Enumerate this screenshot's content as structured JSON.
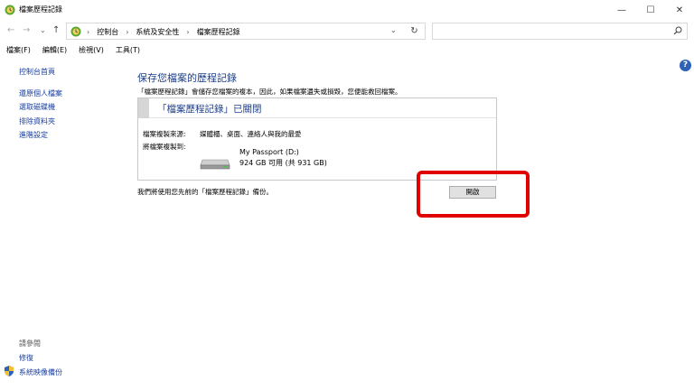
{
  "window": {
    "title": "檔案歷程記錄",
    "minimize": "—",
    "maximize": "☐",
    "close": "✕"
  },
  "address": {
    "back": "←",
    "forward": "→",
    "history": "⌄",
    "up": "↑",
    "crumbs": [
      "控制台",
      "系統及安全性",
      "檔案歷程記錄"
    ],
    "separator": "›",
    "dropdown": "⌄",
    "refresh": "↻",
    "search_placeholder": "",
    "search_icon": "⚲"
  },
  "menu": [
    "檔案(F)",
    "編輯(E)",
    "檢視(V)",
    "工具(T)"
  ],
  "sidebar": {
    "home": "控制台首頁",
    "items": [
      "還原個人檔案",
      "選取磁碟機",
      "排除資料夾",
      "進階設定"
    ],
    "see_also_title": "請參閱",
    "see_also": [
      "修復",
      "系統映像備份"
    ]
  },
  "help": "?",
  "main": {
    "title": "保存您檔案的歷程記錄",
    "description": "「檔案歷程記錄」會儲存您檔案的複本，因此，如果檔案遺失或損毀，您便能救回檔案。",
    "status": "「檔案歷程記錄」已關閉",
    "copy_from_label": "檔案複製來源:",
    "copy_from_value": "媒體櫃、桌面、連絡人與我的最愛",
    "copy_to_label": "將檔案複製到:",
    "drive_name": "My Passport (D:)",
    "drive_space": "924 GB 可用 (共 931 GB)",
    "footer_note": "我們將使用您先前的「檔案歷程記錄」備份。",
    "enable_button": "開啟"
  },
  "colors": {
    "link": "#1a3e9e",
    "heading": "#1e3f8a",
    "highlight": "#e00000"
  }
}
